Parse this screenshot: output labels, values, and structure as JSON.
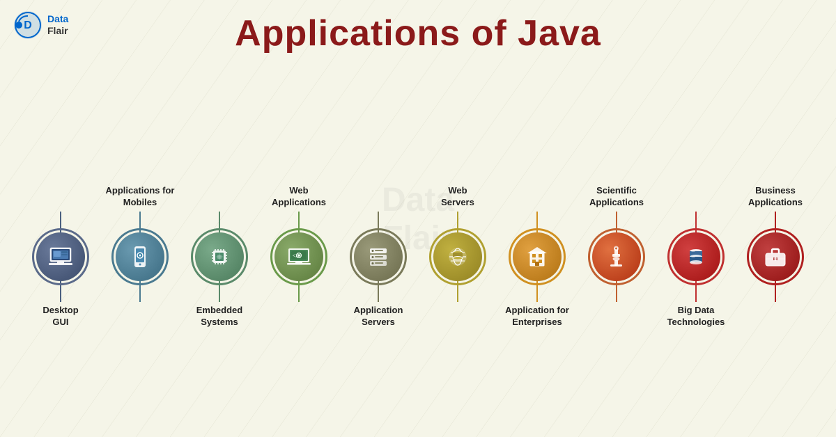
{
  "page": {
    "title": "Applications of Java",
    "background_color": "#f5f5e8"
  },
  "logo": {
    "text_line1": "Data",
    "text_line2": "Flair"
  },
  "items": [
    {
      "id": 0,
      "top_label": "",
      "bottom_label": "Desktop\nGUI",
      "position": "bottom",
      "icon": "desktop",
      "color_class": "item-0"
    },
    {
      "id": 1,
      "top_label": "Applications for\nMobiles",
      "bottom_label": "",
      "position": "top",
      "icon": "mobile",
      "color_class": "item-1"
    },
    {
      "id": 2,
      "top_label": "",
      "bottom_label": "Embedded\nSystems",
      "position": "bottom",
      "icon": "chip",
      "color_class": "item-2"
    },
    {
      "id": 3,
      "top_label": "Web\nApplications",
      "bottom_label": "",
      "position": "top",
      "icon": "webapps",
      "color_class": "item-3"
    },
    {
      "id": 4,
      "top_label": "",
      "bottom_label": "Application\nServers",
      "position": "bottom",
      "icon": "server",
      "color_class": "item-4"
    },
    {
      "id": 5,
      "top_label": "Web\nServers",
      "bottom_label": "",
      "position": "top",
      "icon": "webserver",
      "color_class": "item-5"
    },
    {
      "id": 6,
      "top_label": "",
      "bottom_label": "Application for\nEnterprises",
      "position": "bottom",
      "icon": "enterprise",
      "color_class": "item-6"
    },
    {
      "id": 7,
      "top_label": "Scientific\nApplications",
      "bottom_label": "",
      "position": "top",
      "icon": "science",
      "color_class": "item-7"
    },
    {
      "id": 8,
      "top_label": "",
      "bottom_label": "Big Data\nTechnologies",
      "position": "bottom",
      "icon": "bigdata",
      "color_class": "item-8"
    },
    {
      "id": 9,
      "top_label": "Business\nApplications",
      "bottom_label": "",
      "position": "top",
      "icon": "business",
      "color_class": "item-9"
    }
  ]
}
